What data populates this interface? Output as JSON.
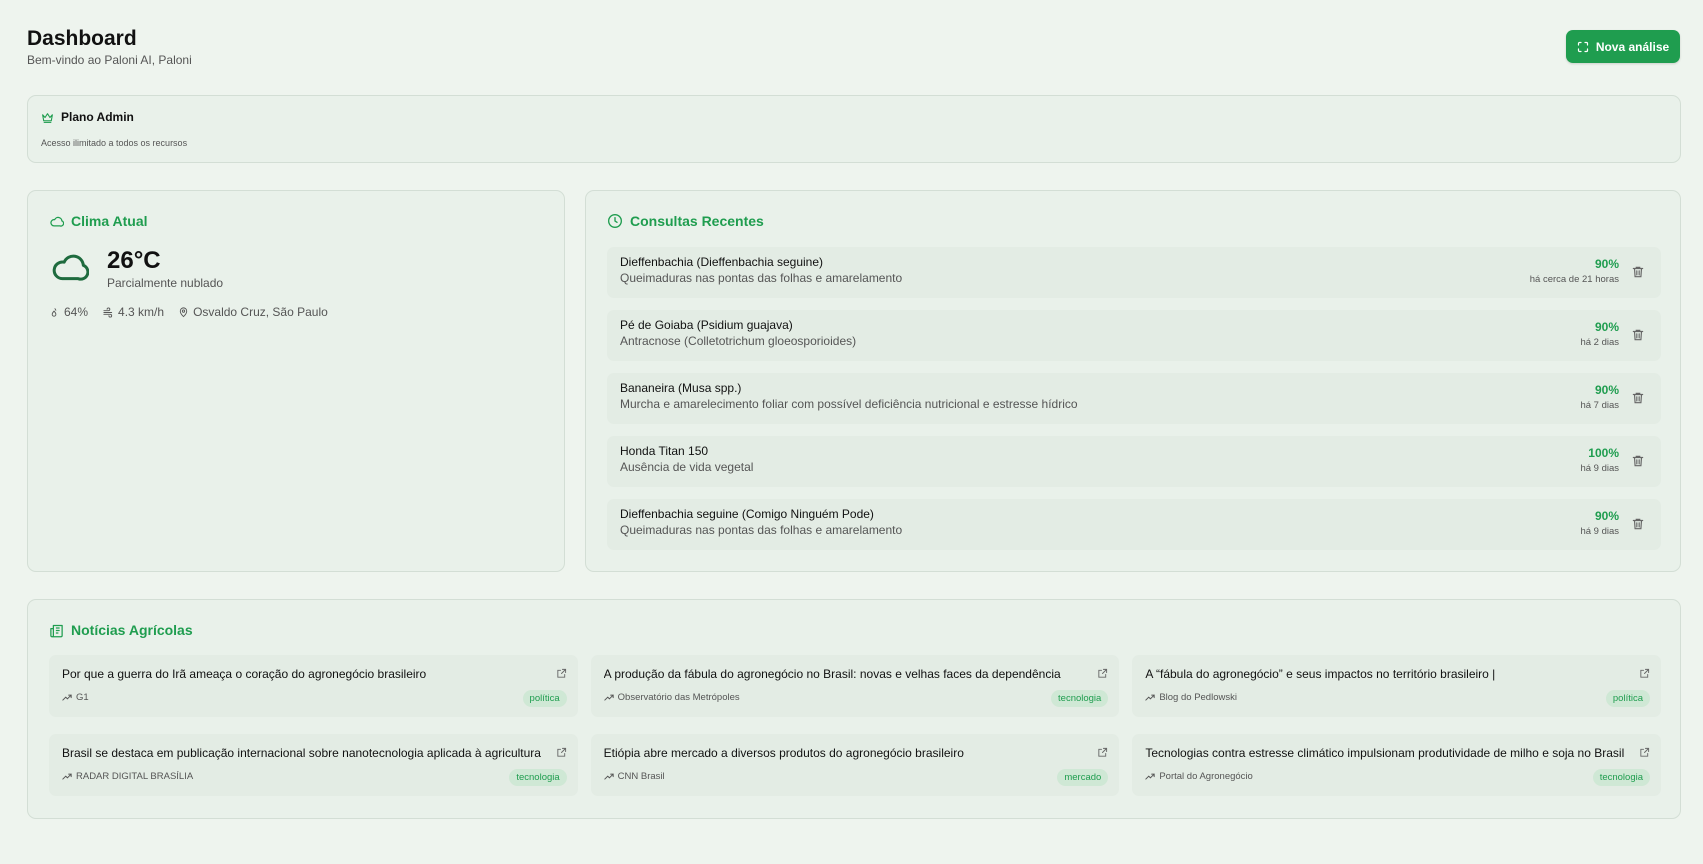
{
  "header": {
    "title": "Dashboard",
    "subtitle": "Bem-vindo ao Paloni AI, Paloni",
    "new_analysis_label": "Nova análise"
  },
  "plan": {
    "title": "Plano Admin",
    "description": "Acesso ilimitado a todos os recursos"
  },
  "weather": {
    "title": "Clima Atual",
    "temperature": "26°C",
    "condition": "Parcialmente nublado",
    "humidity": "64%",
    "wind": "4.3 km/h",
    "location": "Osvaldo Cruz, São Paulo"
  },
  "recent": {
    "title": "Consultas Recentes",
    "items": [
      {
        "name": "Dieffenbachia (Dieffenbachia seguine)",
        "desc": "Queimaduras nas pontas das folhas e amarelamento",
        "pct": "90%",
        "time": "há cerca de 21 horas"
      },
      {
        "name": "Pé de Goiaba (Psidium guajava)",
        "desc": "Antracnose (Colletotrichum gloeosporioides)",
        "pct": "90%",
        "time": "há 2 dias"
      },
      {
        "name": "Bananeira (Musa spp.)",
        "desc": "Murcha e amarelecimento foliar com possível deficiência nutricional e estresse hídrico",
        "pct": "90%",
        "time": "há 7 dias"
      },
      {
        "name": "Honda Titan 150",
        "desc": "Ausência de vida vegetal",
        "pct": "100%",
        "time": "há 9 dias"
      },
      {
        "name": "Dieffenbachia seguine (Comigo Ninguém Pode)",
        "desc": "Queimaduras nas pontas das folhas e amarelamento",
        "pct": "90%",
        "time": "há 9 dias"
      }
    ]
  },
  "news": {
    "title": "Notícias Agrícolas",
    "items": [
      {
        "title": "Por que a guerra do Irã ameaça o coração do agronegócio brasileiro",
        "source": "G1",
        "tag": "política"
      },
      {
        "title": "A produção da fábula do agronegócio no Brasil: novas e velhas faces da dependência",
        "source": "Observatório das Metrópoles",
        "tag": "tecnologia"
      },
      {
        "title": "A “fábula do agronegócio” e seus impactos no território brasileiro |",
        "source": "Blog do Pedlowski",
        "tag": "política"
      },
      {
        "title": "Brasil se destaca em publicação internacional sobre nanotecnologia aplicada à agricultura",
        "source": "RADAR DIGITAL BRASÍLIA",
        "tag": "tecnologia"
      },
      {
        "title": "Etiópia abre mercado a diversos produtos do agronegócio brasileiro",
        "source": "CNN Brasil",
        "tag": "mercado"
      },
      {
        "title": "Tecnologias contra estresse climático impulsionam produtividade de milho e soja no Brasil",
        "source": "Portal do Agronegócio",
        "tag": "tecnologia"
      }
    ]
  },
  "colors": {
    "accent": "#1f9d4f",
    "background": "#eef4ee",
    "card": "#e9f1ea",
    "weather_icon": "#1e6b3e"
  },
  "icons": {
    "new_analysis": "scan-icon",
    "plan": "crown-icon",
    "weather": "cloud-icon",
    "humidity": "droplets-icon",
    "wind": "wind-icon",
    "location": "map-pin-icon",
    "recent": "clock-icon",
    "delete": "trash-icon",
    "news": "newspaper-icon",
    "external": "external-link-icon",
    "source": "trending-up-icon"
  }
}
